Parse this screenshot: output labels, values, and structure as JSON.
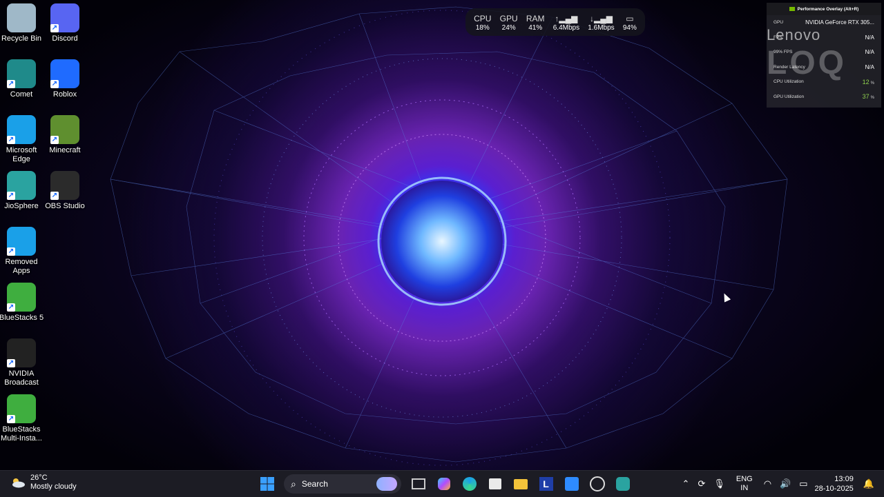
{
  "desktop_icons": [
    {
      "label": "Recycle Bin",
      "icon": "recycle-bin-icon",
      "color": "#9fb8c8"
    },
    {
      "label": "Discord",
      "icon": "discord-icon",
      "color": "#5865f2"
    },
    {
      "label": "Comet",
      "icon": "comet-icon",
      "color": "#1f8a8a"
    },
    {
      "label": "Roblox",
      "icon": "roblox-icon",
      "color": "#1f6bff"
    },
    {
      "label": "Microsoft Edge",
      "icon": "edge-icon",
      "color": "#1aa0e8"
    },
    {
      "label": "Minecraft",
      "icon": "minecraft-icon",
      "color": "#5f8f2f"
    },
    {
      "label": "JioSphere",
      "icon": "jiosphere-icon",
      "color": "#2aa3a0"
    },
    {
      "label": "OBS Studio",
      "icon": "obs-icon",
      "color": "#2b2b2b"
    },
    {
      "label": "Removed Apps",
      "icon": "edge-icon",
      "color": "#1aa0e8"
    },
    {
      "label": "BlueStacks 5",
      "icon": "bluestacks-icon",
      "color": "#3fae3f"
    },
    {
      "label": "NVIDIA Broadcast",
      "icon": "nvidia-broadcast-icon",
      "color": "#222"
    },
    {
      "label": "BlueStacks Multi-Insta...",
      "icon": "bluestacks-multi-icon",
      "color": "#3fae3f"
    }
  ],
  "stats_widget": {
    "cpu_label": "CPU",
    "cpu": "18%",
    "gpu_label": "GPU",
    "gpu": "24%",
    "ram_label": "RAM",
    "ram": "41%",
    "up": "6.4Mbps",
    "down": "1.6Mbps",
    "battery": "94%"
  },
  "perf_overlay": {
    "title": "Performance Overlay (Alt+R)",
    "watermark": "Lenovo",
    "rows": [
      {
        "label": "GPU",
        "value": "NVIDIA GeForce RTX 305..."
      },
      {
        "label": "FPS",
        "value": "N/A"
      },
      {
        "label": "99% FPS",
        "value": "N/A"
      },
      {
        "label": "Render Latency",
        "value": "N/A"
      },
      {
        "label": "CPU Utilization",
        "value": "12",
        "unit": "%"
      },
      {
        "label": "GPU Utilization",
        "value": "37",
        "unit": "%"
      }
    ]
  },
  "taskbar": {
    "weather_temp": "26°C",
    "weather_desc": "Mostly cloudy",
    "search_placeholder": "Search",
    "lang_top": "ENG",
    "lang_bottom": "IN",
    "time": "13:09",
    "date": "28-10-2025"
  }
}
